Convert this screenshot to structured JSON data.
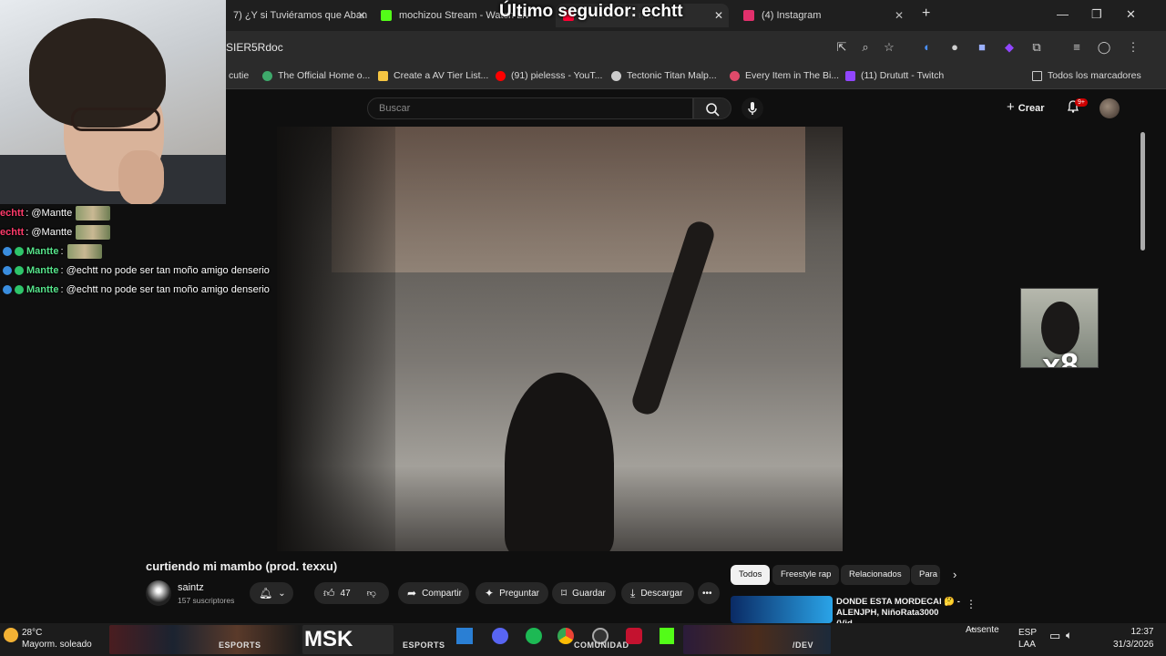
{
  "browser": {
    "tabs": [
      {
        "title": "7) ¿Y si Tuviéramos que Aban",
        "fav_color": "#ff0000"
      },
      {
        "title": "mochizou Stream - Watch Liv",
        "fav_color": "#53fc18"
      },
      {
        "title": "curtiendo mi mambo",
        "fav_color": "#ff0033"
      },
      {
        "title": "(4) Instagram",
        "fav_color": "#e1306c"
      }
    ],
    "new_tab_label": "+",
    "url": "SIER5Rdoc",
    "bookmarks": [
      {
        "label": "cutie",
        "color": "#888888"
      },
      {
        "label": "The Official Home o...",
        "color": "#3ea96b"
      },
      {
        "label": "Create a AV Tier List...",
        "color": "#f5c542"
      },
      {
        "label": "(91) pielesss - YouT...",
        "color": "#ff0000"
      },
      {
        "label": "Tectonic Titan Malp...",
        "color": "#cccccc"
      },
      {
        "label": "Every Item in The Bi...",
        "color": "#e04a6a"
      },
      {
        "label": "(11) Drututt - Twitch",
        "color": "#9146ff"
      }
    ],
    "all_bookmarks_label": "Todos los marcadores"
  },
  "stream_overlay": {
    "follower_text": "Último seguidor: echtt",
    "chat": [
      {
        "user": "echtt",
        "user_color": "#ff3b6b",
        "message": ": @Mantte",
        "emote": true,
        "badges": false
      },
      {
        "user": "echtt",
        "user_color": "#ff3b6b",
        "message": ": @Mantte",
        "emote": true,
        "badges": false
      },
      {
        "user": "Mantte",
        "user_color": "#56e38a",
        "message": ":",
        "emote": true,
        "badges": true
      },
      {
        "user": "Mantte",
        "user_color": "#56e38a",
        "message": ": @echtt no pode ser tan moño amigo denserio",
        "emote": false,
        "badges": true
      },
      {
        "user": "Mantte",
        "user_color": "#56e38a",
        "message": ": @echtt no pode ser tan moño amigo denserio",
        "emote": false,
        "badges": true
      }
    ]
  },
  "youtube": {
    "search_placeholder": "Buscar",
    "create_label": "Crear",
    "notification_count": "9+",
    "mini_overlay_text": "x8",
    "video_title": "curtiendo mi mambo (prod. texxu)",
    "channel_name": "saintz",
    "subscribers": "157 suscriptores",
    "like_count": "47",
    "share_label": "Compartir",
    "ask_label": "Preguntar",
    "save_label": "Guardar",
    "download_label": "Descargar",
    "chips": [
      "Todos",
      "Freestyle rap",
      "Relacionados",
      "Para ti"
    ],
    "rec_title": "DONDE ESTA MORDECAI 🤔 - ALENJPH, NiñoRata3000 (Vid..."
  },
  "taskbar": {
    "temperature": "28°C",
    "weather": "Mayorm. soleado",
    "esports_label": "ESPORTS",
    "comunidad_label": "COMUNIDAD",
    "dev_label": "/DEV",
    "status": "Ausente",
    "lang1": "ESP",
    "lang2": "LAA",
    "time": "12:37",
    "date": "31/3/2026"
  }
}
